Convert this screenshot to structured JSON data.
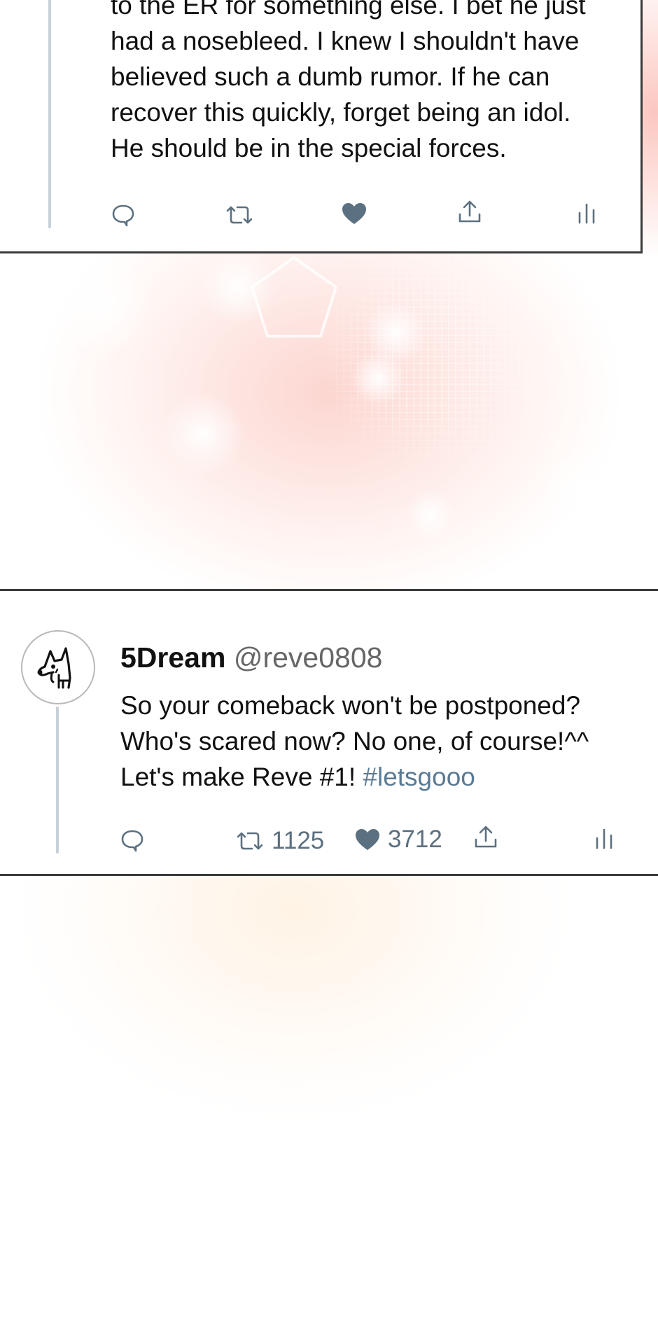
{
  "tweet_top": {
    "lines": [
      "to the ER for something else. I bet he just",
      "had a nosebleed. I knew I shouldn't have",
      "believed such a dumb rumor. If he can",
      "recover this quickly, forget being an idol.",
      "He should be in the special forces."
    ],
    "actions": {
      "reply": "reply-icon",
      "retweet": "retweet-icon",
      "like": "heart-icon",
      "share": "share-icon",
      "stats": "stats-icon"
    }
  },
  "tweet_bottom": {
    "display_name": "5Dream",
    "handle": "@reve0808",
    "lines": [
      "So your comeback won't be postponed?",
      "Who's scared now? No one, of course!^^",
      "Let's make Reve #1! "
    ],
    "hashtag": "#letsgooo",
    "retweet_count": "1125",
    "like_count": "3712"
  },
  "colors": {
    "icon": "#5b7080",
    "hashtag": "#5b7a93",
    "border": "#3a3a3a",
    "thread_line": "#c8d0d8",
    "background_tint": "#f9c6bd"
  }
}
